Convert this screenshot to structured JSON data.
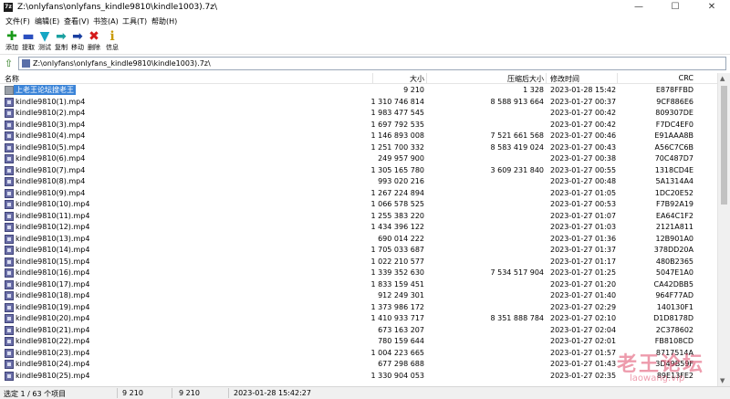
{
  "window": {
    "title": "Z:\\onlyfans\\onlyfans_kindle9810\\kindle1003).7z\\",
    "icon": "7z-app-icon",
    "controls": {
      "minimize": "—",
      "maximize": "☐",
      "close": "✕"
    }
  },
  "menu": [
    "文件(F)",
    "编辑(E)",
    "查看(V)",
    "书签(A)",
    "工具(T)",
    "帮助(H)"
  ],
  "toolbar": [
    {
      "label": "添加",
      "icon": "add-icon",
      "glyph": "✚",
      "color": "#1a9a1a"
    },
    {
      "label": "提取",
      "icon": "extract-icon",
      "glyph": "▬",
      "color": "#2b4fbf"
    },
    {
      "label": "测试",
      "icon": "test-icon",
      "glyph": "▼",
      "color": "#17a6c4"
    },
    {
      "label": "复制",
      "icon": "copy-icon",
      "glyph": "➡",
      "color": "#1aa0a0"
    },
    {
      "label": "移动",
      "icon": "move-icon",
      "glyph": "➡",
      "color": "#1a3fa0"
    },
    {
      "label": "删除",
      "icon": "delete-icon",
      "glyph": "✖",
      "color": "#d41a1a"
    },
    {
      "label": "信息",
      "icon": "info-icon",
      "glyph": "ℹ",
      "color": "#c89a00"
    }
  ],
  "address": {
    "path": "Z:\\onlyfans\\onlyfans_kindle9810\\kindle1003).7z\\"
  },
  "columns": {
    "name": "名称",
    "size": "大小",
    "packed": "压缩后大小",
    "modified": "修改时间",
    "crc": "CRC"
  },
  "parent_row": {
    "name": "上老王论坛搜老王",
    "size": "9 210",
    "packed": "1 328",
    "modified": "2023-01-28 15:42",
    "crc": "E878FFBD"
  },
  "files": [
    {
      "name": "kindle9810(1).mp4",
      "size": "1 310 746 814",
      "packed": "8 588 913 664",
      "modified": "2023-01-27 00:37",
      "crc": "9CF886E6"
    },
    {
      "name": "kindle9810(2).mp4",
      "size": "1 983 477 545",
      "packed": "",
      "modified": "2023-01-27 00:42",
      "crc": "809307DE"
    },
    {
      "name": "kindle9810(3).mp4",
      "size": "1 697 792 535",
      "packed": "",
      "modified": "2023-01-27 00:42",
      "crc": "F7DC4EF0"
    },
    {
      "name": "kindle9810(4).mp4",
      "size": "1 146 893 008",
      "packed": "7 521 661 568",
      "modified": "2023-01-27 00:46",
      "crc": "E91AAA8B"
    },
    {
      "name": "kindle9810(5).mp4",
      "size": "1 251 700 332",
      "packed": "8 583 419 024",
      "modified": "2023-01-27 00:43",
      "crc": "A56C7C6B"
    },
    {
      "name": "kindle9810(6).mp4",
      "size": "249 957 900",
      "packed": "",
      "modified": "2023-01-27 00:38",
      "crc": "70C487D7"
    },
    {
      "name": "kindle9810(7).mp4",
      "size": "1 305 165 780",
      "packed": "3 609 231 840",
      "modified": "2023-01-27 00:55",
      "crc": "1318CD4E"
    },
    {
      "name": "kindle9810(8).mp4",
      "size": "993 020 216",
      "packed": "",
      "modified": "2023-01-27 00:48",
      "crc": "5A1314A4"
    },
    {
      "name": "kindle9810(9).mp4",
      "size": "1 267 224 894",
      "packed": "",
      "modified": "2023-01-27 01:05",
      "crc": "1DC20E52"
    },
    {
      "name": "kindle9810(10).mp4",
      "size": "1 066 578 525",
      "packed": "",
      "modified": "2023-01-27 00:53",
      "crc": "F7B92A19"
    },
    {
      "name": "kindle9810(11).mp4",
      "size": "1 255 383 220",
      "packed": "",
      "modified": "2023-01-27 01:07",
      "crc": "EA64C1F2"
    },
    {
      "name": "kindle9810(12).mp4",
      "size": "1 434 396 122",
      "packed": "",
      "modified": "2023-01-27 01:03",
      "crc": "2121A811"
    },
    {
      "name": "kindle9810(13).mp4",
      "size": "690 014 222",
      "packed": "",
      "modified": "2023-01-27 01:36",
      "crc": "12B901A0"
    },
    {
      "name": "kindle9810(14).mp4",
      "size": "1 705 033 687",
      "packed": "",
      "modified": "2023-01-27 01:37",
      "crc": "378DD20A"
    },
    {
      "name": "kindle9810(15).mp4",
      "size": "1 022 210 577",
      "packed": "",
      "modified": "2023-01-27 01:17",
      "crc": "480B2365"
    },
    {
      "name": "kindle9810(16).mp4",
      "size": "1 339 352 630",
      "packed": "7 534 517 904",
      "modified": "2023-01-27 01:25",
      "crc": "5047E1A0"
    },
    {
      "name": "kindle9810(17).mp4",
      "size": "1 833 159 451",
      "packed": "",
      "modified": "2023-01-27 01:20",
      "crc": "CA42DBB5"
    },
    {
      "name": "kindle9810(18).mp4",
      "size": "912 249 301",
      "packed": "",
      "modified": "2023-01-27 01:40",
      "crc": "964F77AD"
    },
    {
      "name": "kindle9810(19).mp4",
      "size": "1 373 986 172",
      "packed": "",
      "modified": "2023-01-27 02:29",
      "crc": "140130F1"
    },
    {
      "name": "kindle9810(20).mp4",
      "size": "1 410 933 717",
      "packed": "8 351 888 784",
      "modified": "2023-01-27 02:10",
      "crc": "D1D8178D"
    },
    {
      "name": "kindle9810(21).mp4",
      "size": "673 163 207",
      "packed": "",
      "modified": "2023-01-27 02:04",
      "crc": "2C378602"
    },
    {
      "name": "kindle9810(22).mp4",
      "size": "780 159 644",
      "packed": "",
      "modified": "2023-01-27 02:01",
      "crc": "FB8108CD"
    },
    {
      "name": "kindle9810(23).mp4",
      "size": "1 004 223 665",
      "packed": "",
      "modified": "2023-01-27 01:57",
      "crc": "8717514A"
    },
    {
      "name": "kindle9810(24).mp4",
      "size": "677 298 688",
      "packed": "",
      "modified": "2023-01-27 01:43",
      "crc": "3D49B59F"
    },
    {
      "name": "kindle9810(25).mp4",
      "size": "1 330 904 053",
      "packed": "",
      "modified": "2023-01-27 02:35",
      "crc": "89E13FE2"
    }
  ],
  "status": {
    "selection": "选定 1 / 63 个项目",
    "size": "9 210",
    "packed": "9 210",
    "modified": "2023-01-28 15:42:27"
  },
  "watermark": {
    "main": "老王论坛",
    "sub": "laowang.vip"
  }
}
